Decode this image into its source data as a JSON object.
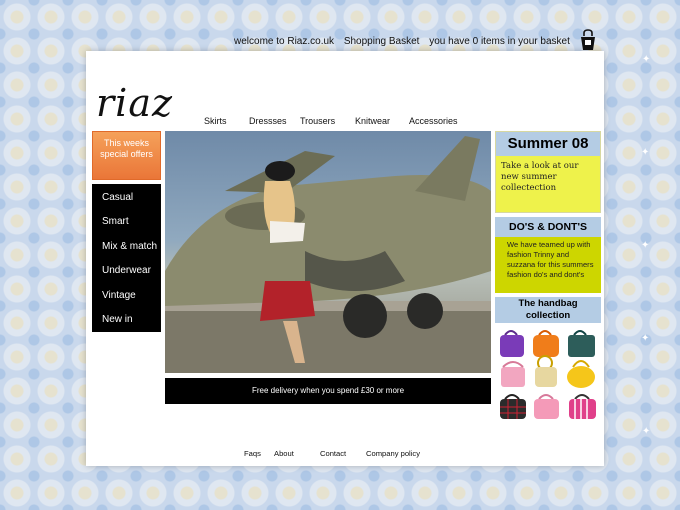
{
  "header": {
    "welcome": "welcome to Riaz.co.uk",
    "basket_link": "Shopping Basket",
    "basket_status": "you have 0 items in your basket"
  },
  "brand": {
    "logo": "riaz"
  },
  "top_nav": [
    "Skirts",
    "Dressses",
    "Trousers",
    "Knitwear",
    "Accessories"
  ],
  "offers": {
    "label": "This weeks special offers"
  },
  "side_menu": [
    "Casual",
    "Smart",
    "Mix & match",
    "Underwear",
    "Vintage",
    "New in"
  ],
  "banner": {
    "delivery": "Free delivery when you spend £30 or more"
  },
  "summer": {
    "title": "Summer 08",
    "text": "Take a look at our new summer collectection"
  },
  "dos": {
    "title": "DO'S & DONT'S",
    "text": "We have teamed up with fashion Trinny and suzzana for this summers fashion do's and dont's"
  },
  "handbag": {
    "title": "The handbag collection"
  },
  "footer": [
    "Faqs",
    "About",
    "Contact",
    "Company policy"
  ],
  "colors": {
    "offers": "#ea7638",
    "menu": "#000000",
    "summer_bg": "#eef24b",
    "dos_bg": "#cdd600",
    "panel_head": "#b4cce4"
  },
  "icons": {
    "basket": "shopping-bag-icon"
  }
}
